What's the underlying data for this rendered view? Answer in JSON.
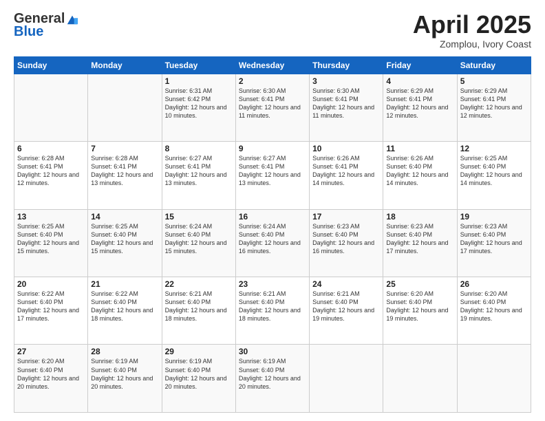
{
  "logo": {
    "general": "General",
    "blue": "Blue"
  },
  "title": {
    "month": "April 2025",
    "location": "Zomplou, Ivory Coast"
  },
  "weekdays": [
    "Sunday",
    "Monday",
    "Tuesday",
    "Wednesday",
    "Thursday",
    "Friday",
    "Saturday"
  ],
  "weeks": [
    [
      {
        "day": "",
        "sunrise": "",
        "sunset": "",
        "daylight": ""
      },
      {
        "day": "",
        "sunrise": "",
        "sunset": "",
        "daylight": ""
      },
      {
        "day": "1",
        "sunrise": "Sunrise: 6:31 AM",
        "sunset": "Sunset: 6:42 PM",
        "daylight": "Daylight: 12 hours and 10 minutes."
      },
      {
        "day": "2",
        "sunrise": "Sunrise: 6:30 AM",
        "sunset": "Sunset: 6:41 PM",
        "daylight": "Daylight: 12 hours and 11 minutes."
      },
      {
        "day": "3",
        "sunrise": "Sunrise: 6:30 AM",
        "sunset": "Sunset: 6:41 PM",
        "daylight": "Daylight: 12 hours and 11 minutes."
      },
      {
        "day": "4",
        "sunrise": "Sunrise: 6:29 AM",
        "sunset": "Sunset: 6:41 PM",
        "daylight": "Daylight: 12 hours and 12 minutes."
      },
      {
        "day": "5",
        "sunrise": "Sunrise: 6:29 AM",
        "sunset": "Sunset: 6:41 PM",
        "daylight": "Daylight: 12 hours and 12 minutes."
      }
    ],
    [
      {
        "day": "6",
        "sunrise": "Sunrise: 6:28 AM",
        "sunset": "Sunset: 6:41 PM",
        "daylight": "Daylight: 12 hours and 12 minutes."
      },
      {
        "day": "7",
        "sunrise": "Sunrise: 6:28 AM",
        "sunset": "Sunset: 6:41 PM",
        "daylight": "Daylight: 12 hours and 13 minutes."
      },
      {
        "day": "8",
        "sunrise": "Sunrise: 6:27 AM",
        "sunset": "Sunset: 6:41 PM",
        "daylight": "Daylight: 12 hours and 13 minutes."
      },
      {
        "day": "9",
        "sunrise": "Sunrise: 6:27 AM",
        "sunset": "Sunset: 6:41 PM",
        "daylight": "Daylight: 12 hours and 13 minutes."
      },
      {
        "day": "10",
        "sunrise": "Sunrise: 6:26 AM",
        "sunset": "Sunset: 6:41 PM",
        "daylight": "Daylight: 12 hours and 14 minutes."
      },
      {
        "day": "11",
        "sunrise": "Sunrise: 6:26 AM",
        "sunset": "Sunset: 6:40 PM",
        "daylight": "Daylight: 12 hours and 14 minutes."
      },
      {
        "day": "12",
        "sunrise": "Sunrise: 6:25 AM",
        "sunset": "Sunset: 6:40 PM",
        "daylight": "Daylight: 12 hours and 14 minutes."
      }
    ],
    [
      {
        "day": "13",
        "sunrise": "Sunrise: 6:25 AM",
        "sunset": "Sunset: 6:40 PM",
        "daylight": "Daylight: 12 hours and 15 minutes."
      },
      {
        "day": "14",
        "sunrise": "Sunrise: 6:25 AM",
        "sunset": "Sunset: 6:40 PM",
        "daylight": "Daylight: 12 hours and 15 minutes."
      },
      {
        "day": "15",
        "sunrise": "Sunrise: 6:24 AM",
        "sunset": "Sunset: 6:40 PM",
        "daylight": "Daylight: 12 hours and 15 minutes."
      },
      {
        "day": "16",
        "sunrise": "Sunrise: 6:24 AM",
        "sunset": "Sunset: 6:40 PM",
        "daylight": "Daylight: 12 hours and 16 minutes."
      },
      {
        "day": "17",
        "sunrise": "Sunrise: 6:23 AM",
        "sunset": "Sunset: 6:40 PM",
        "daylight": "Daylight: 12 hours and 16 minutes."
      },
      {
        "day": "18",
        "sunrise": "Sunrise: 6:23 AM",
        "sunset": "Sunset: 6:40 PM",
        "daylight": "Daylight: 12 hours and 17 minutes."
      },
      {
        "day": "19",
        "sunrise": "Sunrise: 6:23 AM",
        "sunset": "Sunset: 6:40 PM",
        "daylight": "Daylight: 12 hours and 17 minutes."
      }
    ],
    [
      {
        "day": "20",
        "sunrise": "Sunrise: 6:22 AM",
        "sunset": "Sunset: 6:40 PM",
        "daylight": "Daylight: 12 hours and 17 minutes."
      },
      {
        "day": "21",
        "sunrise": "Sunrise: 6:22 AM",
        "sunset": "Sunset: 6:40 PM",
        "daylight": "Daylight: 12 hours and 18 minutes."
      },
      {
        "day": "22",
        "sunrise": "Sunrise: 6:21 AM",
        "sunset": "Sunset: 6:40 PM",
        "daylight": "Daylight: 12 hours and 18 minutes."
      },
      {
        "day": "23",
        "sunrise": "Sunrise: 6:21 AM",
        "sunset": "Sunset: 6:40 PM",
        "daylight": "Daylight: 12 hours and 18 minutes."
      },
      {
        "day": "24",
        "sunrise": "Sunrise: 6:21 AM",
        "sunset": "Sunset: 6:40 PM",
        "daylight": "Daylight: 12 hours and 19 minutes."
      },
      {
        "day": "25",
        "sunrise": "Sunrise: 6:20 AM",
        "sunset": "Sunset: 6:40 PM",
        "daylight": "Daylight: 12 hours and 19 minutes."
      },
      {
        "day": "26",
        "sunrise": "Sunrise: 6:20 AM",
        "sunset": "Sunset: 6:40 PM",
        "daylight": "Daylight: 12 hours and 19 minutes."
      }
    ],
    [
      {
        "day": "27",
        "sunrise": "Sunrise: 6:20 AM",
        "sunset": "Sunset: 6:40 PM",
        "daylight": "Daylight: 12 hours and 20 minutes."
      },
      {
        "day": "28",
        "sunrise": "Sunrise: 6:19 AM",
        "sunset": "Sunset: 6:40 PM",
        "daylight": "Daylight: 12 hours and 20 minutes."
      },
      {
        "day": "29",
        "sunrise": "Sunrise: 6:19 AM",
        "sunset": "Sunset: 6:40 PM",
        "daylight": "Daylight: 12 hours and 20 minutes."
      },
      {
        "day": "30",
        "sunrise": "Sunrise: 6:19 AM",
        "sunset": "Sunset: 6:40 PM",
        "daylight": "Daylight: 12 hours and 20 minutes."
      },
      {
        "day": "",
        "sunrise": "",
        "sunset": "",
        "daylight": ""
      },
      {
        "day": "",
        "sunrise": "",
        "sunset": "",
        "daylight": ""
      },
      {
        "day": "",
        "sunrise": "",
        "sunset": "",
        "daylight": ""
      }
    ]
  ]
}
